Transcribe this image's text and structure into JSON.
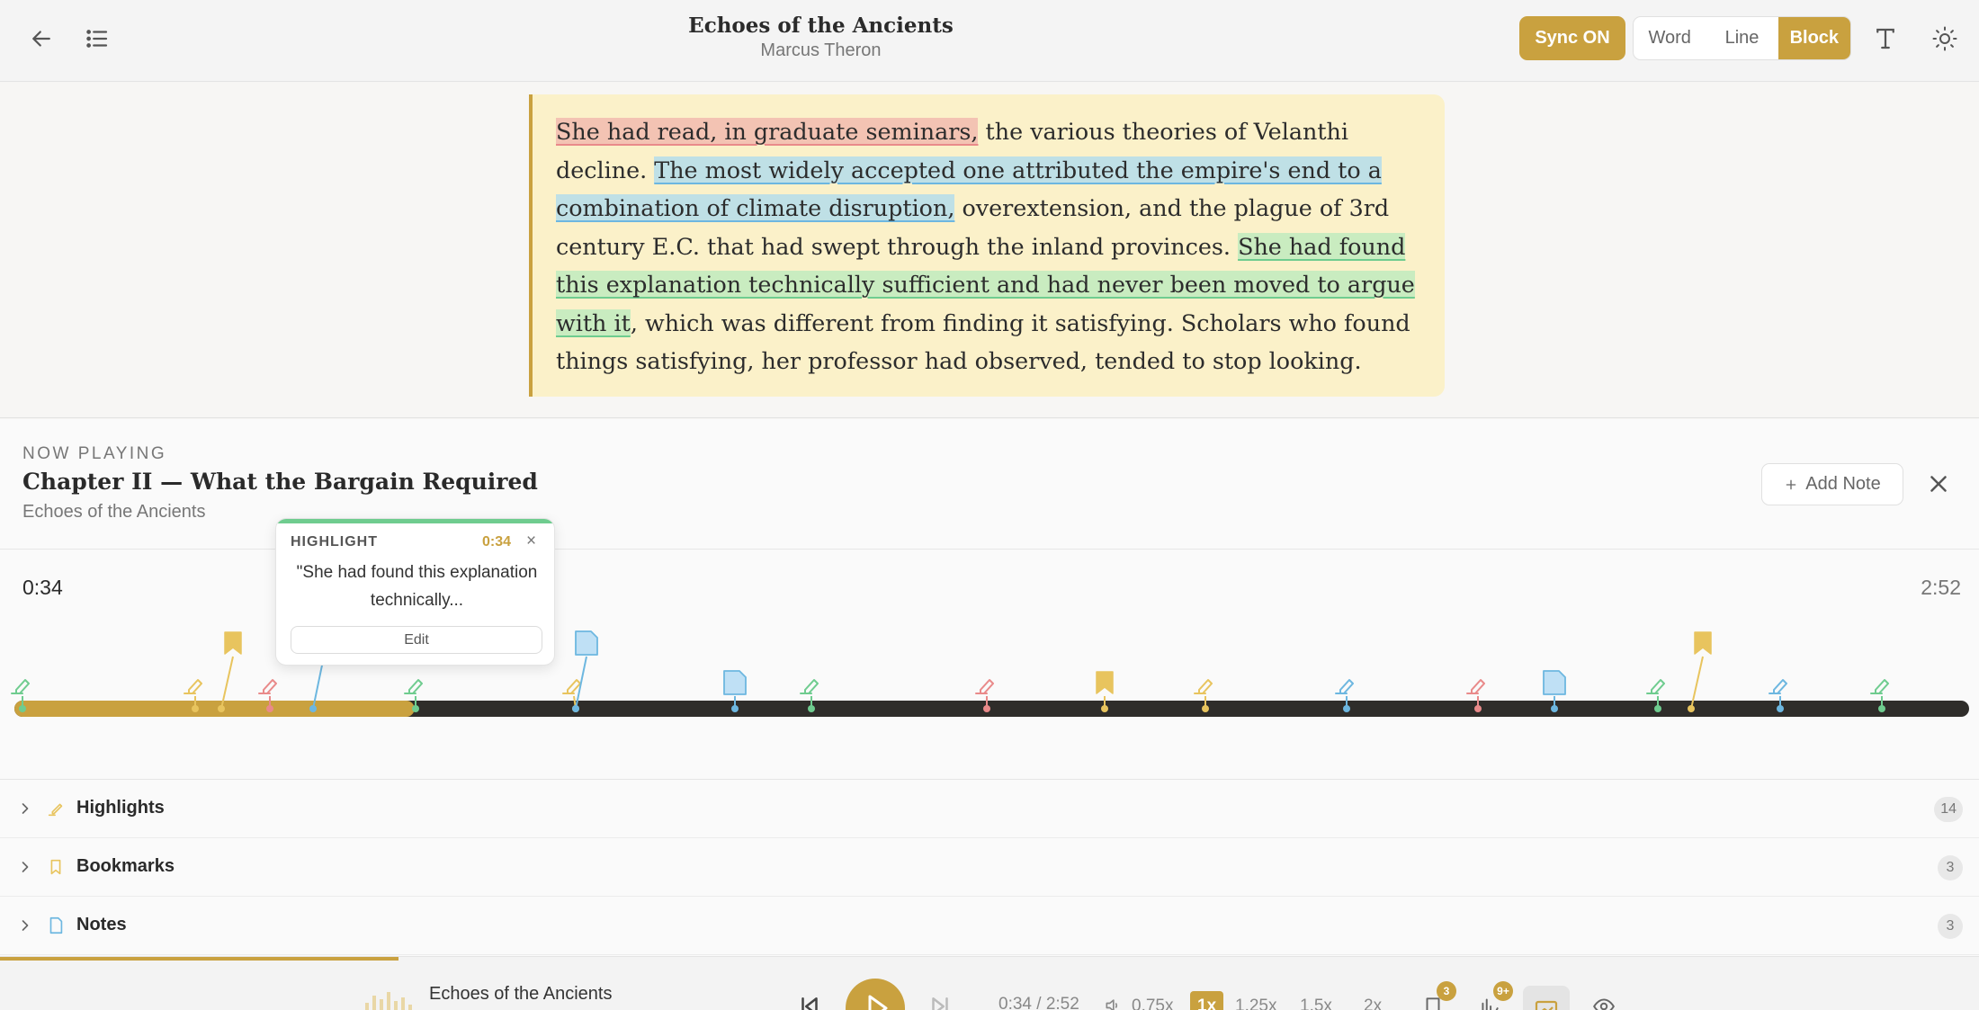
{
  "header": {
    "book_title": "Echoes of the Ancients",
    "author": "Marcus Theron",
    "sync_label": "Sync ON",
    "modes": [
      "Word",
      "Line",
      "Block"
    ],
    "active_mode": "Block"
  },
  "passage": {
    "seg1_hl": "She had read, in graduate seminars,",
    "seg2": " the various theories of Velanthi decline. ",
    "seg3_hl": "The most widely accepted one attributed the empire's end to a combination of climate disruption,",
    "seg4": " overextension, and the plague of 3rd century E.C. that had swept through the inland provinces. ",
    "seg5_hl": "She had found this explanation technically sufficient and had never been moved to argue with it",
    "seg6": ", which was different from finding it satisfying. Scholars who found things satisfying, her professor had observed, tended to stop looking."
  },
  "now_playing": {
    "label": "NOW PLAYING",
    "chapter": "Chapter II — What the Bargain Required",
    "book": "Echoes of the Ancients",
    "add_note": "Add Note"
  },
  "timeline": {
    "current": "0:34",
    "total": "2:52",
    "progress_fraction": 0.198
  },
  "popup": {
    "type": "HIGHLIGHT",
    "time": "0:34",
    "close": "×",
    "text": "\"She had found this explanation technically...",
    "edit": "Edit"
  },
  "sections": [
    {
      "label": "Highlights",
      "count": "14"
    },
    {
      "label": "Bookmarks",
      "count": "3"
    },
    {
      "label": "Notes",
      "count": "3"
    }
  ],
  "bottom": {
    "title": "Echoes of the Ancients",
    "time": "0:34 / 2:52",
    "speeds": [
      "0.75x",
      "1x",
      "1.25x",
      "1.5x",
      "2x"
    ],
    "active_speed": "1x",
    "badge_bookmarks": "3",
    "badge_highlights": "9+"
  },
  "colors": {
    "accent": "#c9a13f",
    "highlight_green": "#6fcc8f",
    "highlight_blue": "#6db7e0",
    "highlight_red": "#e98a8a",
    "highlight_yellow": "#e8c45e"
  }
}
